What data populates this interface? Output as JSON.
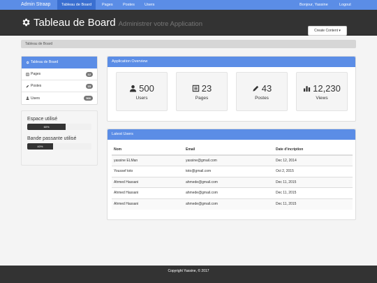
{
  "navbar": {
    "brand": "Admin Straap",
    "links": [
      "Tableau de Board",
      "Pages",
      "Postes",
      "Users"
    ],
    "greeting": "Bonjour, Yassine",
    "logout": "Logout",
    "accent": "#5b8de6"
  },
  "header": {
    "title": "Tableau de Board",
    "subtitle": "Administrer votre Application",
    "create_button": "Create Content",
    "icon": "gear-icon"
  },
  "breadcrumb": "Tableau de Board",
  "sidebar": {
    "items": [
      {
        "label": "Tableau de Board",
        "icon": "gear-icon",
        "badge": ""
      },
      {
        "label": "Pages",
        "icon": "list-icon",
        "badge": "12"
      },
      {
        "label": "Postes",
        "icon": "pencil-icon",
        "badge": "15"
      },
      {
        "label": "Users",
        "icon": "user-icon",
        "badge": "500"
      }
    ]
  },
  "usage": {
    "space_label": "Espace utilisé",
    "space_percent": "60%",
    "space_value": 60,
    "bandwidth_label": "Bande passante utilisé",
    "bandwidth_percent": "40%",
    "bandwidth_value": 40
  },
  "overview": {
    "heading": "Application Overview",
    "stats": [
      {
        "value": "500",
        "label": "Users",
        "icon": "user-icon"
      },
      {
        "value": "23",
        "label": "Pages",
        "icon": "list-icon"
      },
      {
        "value": "43",
        "label": "Postes",
        "icon": "pencil-icon"
      },
      {
        "value": "12,230",
        "label": "Views",
        "icon": "bar-chart-icon"
      }
    ]
  },
  "latest_users": {
    "heading": "Latest Users",
    "columns": [
      "Nom",
      "Email",
      "Date d'incription"
    ],
    "rows": [
      [
        "yassine ELMan",
        "yassine@gmail.com",
        "Dec 12, 2014"
      ],
      [
        "Youssef toto",
        "toto@gmail.com",
        "Oct 2, 2015"
      ],
      [
        "Ahmed Hassani",
        "ahmede@gmail.com",
        "Dec 11, 2015"
      ],
      [
        "Ahmed Hassani",
        "ahmede@gmail.com",
        "Dec 11, 2015"
      ],
      [
        "Ahmed Hassani",
        "ahmede@gmail.com",
        "Dec 11, 2015"
      ]
    ]
  },
  "footer": "Copyright Yassine, © 2017"
}
